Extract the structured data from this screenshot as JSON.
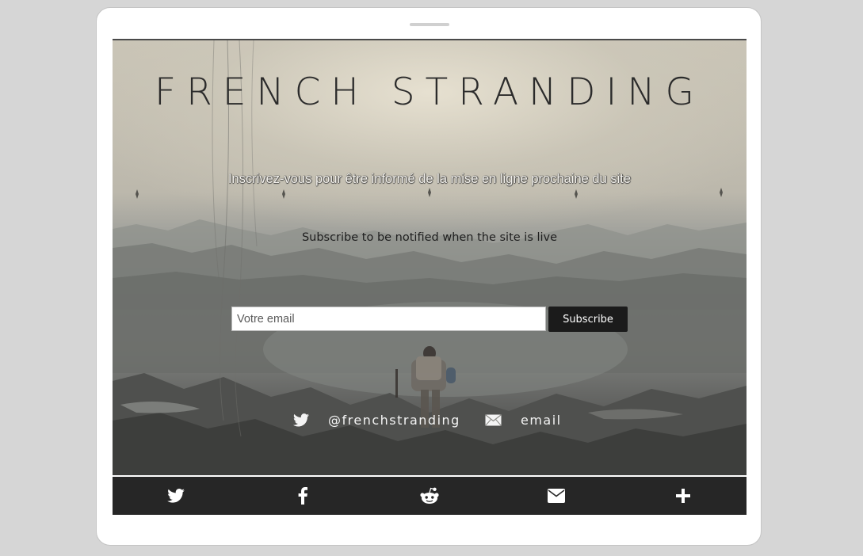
{
  "header": {
    "title": "FRENCH STRANDING"
  },
  "main": {
    "subtitle_fr": "Inscrivez-vous pour être informé de la mise en ligne prochaine du site",
    "subtitle_en": "Subscribe to be notified when the site is live",
    "form": {
      "email_placeholder": "Votre email",
      "email_value": "",
      "subscribe_label": "Subscribe"
    },
    "social": {
      "twitter_handle": "@frenchstranding",
      "twitter_icon": "twitter-icon",
      "email_label": "email",
      "email_icon": "envelope-icon"
    }
  },
  "share_bar": {
    "buttons": [
      {
        "icon": "twitter-icon"
      },
      {
        "icon": "facebook-icon"
      },
      {
        "icon": "reddit-icon"
      },
      {
        "icon": "envelope-icon"
      },
      {
        "icon": "plus-icon"
      }
    ]
  },
  "colors": {
    "page_background": "#d6d6d6",
    "device_frame": "#ffffff",
    "share_bar_background": "#262626",
    "subscribe_button": "#1b1b1b",
    "title_text": "#2b2b2b"
  }
}
